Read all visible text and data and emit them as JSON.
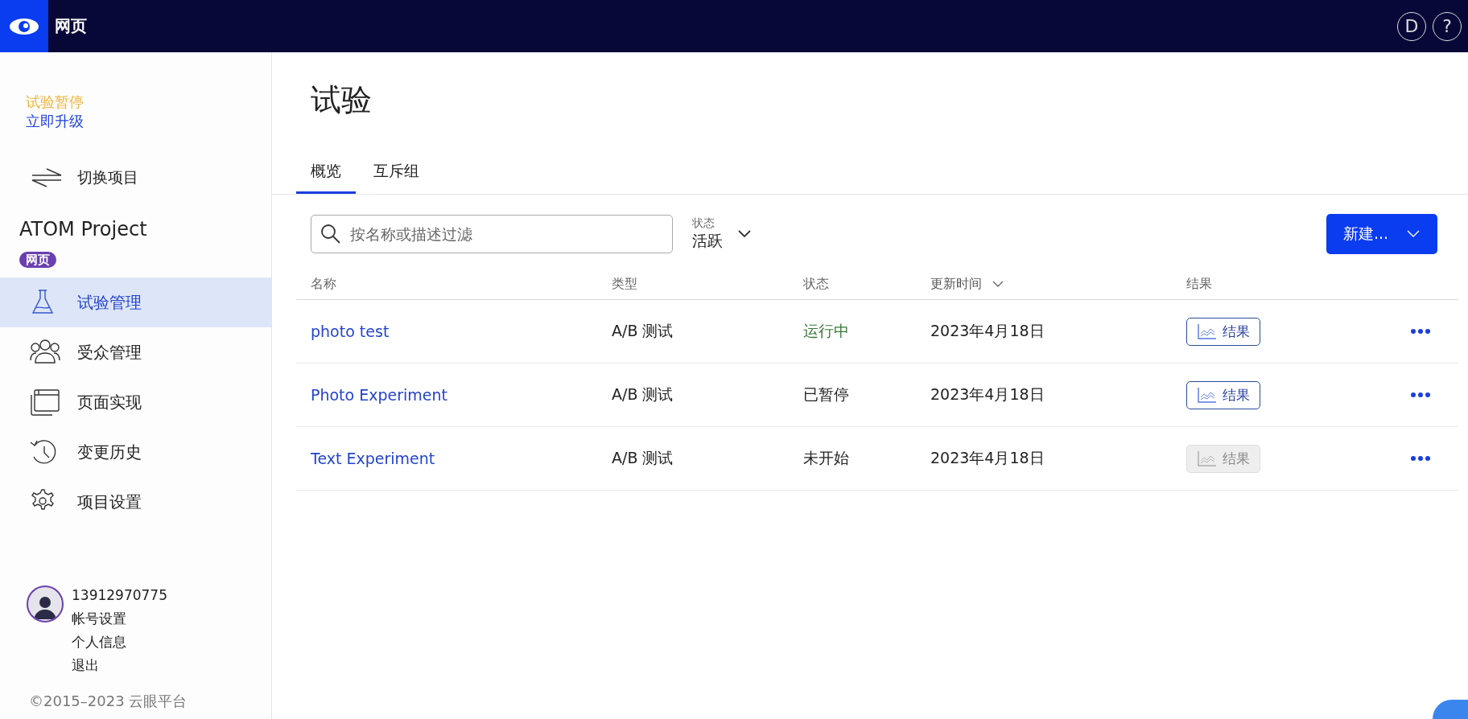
{
  "top_bar": {
    "title": "网页",
    "user_initial": "D",
    "help": "?"
  },
  "sidebar": {
    "trial_notice": "试验暂停",
    "upgrade_link": "立即升级",
    "switch_project": "切换项目",
    "project_name": "ATOM Project",
    "project_badge": "网页",
    "items": [
      {
        "label": "试验管理",
        "selected": true
      },
      {
        "label": "受众管理",
        "selected": false
      },
      {
        "label": "页面实现",
        "selected": false
      },
      {
        "label": "变更历史",
        "selected": false
      },
      {
        "label": "项目设置",
        "selected": false
      }
    ],
    "user": {
      "name": "13912970775",
      "links": [
        "帐号设置",
        "个人信息",
        "退出"
      ]
    },
    "footer": "©2015–2023 云眼平台"
  },
  "main": {
    "title": "试验",
    "tabs": [
      {
        "label": "概览",
        "selected": true
      },
      {
        "label": "互斥组",
        "selected": false
      }
    ],
    "search": {
      "placeholder": "按名称或描述过滤"
    },
    "status_filter": {
      "label": "状态",
      "value": "活跃"
    },
    "new_button": "新建...",
    "table": {
      "columns": [
        {
          "label": "名称",
          "sorted": false
        },
        {
          "label": "类型",
          "sorted": false
        },
        {
          "label": "状态",
          "sorted": false
        },
        {
          "label": "更新时间",
          "sorted": true
        },
        {
          "label": "结果",
          "sorted": false
        }
      ],
      "rows": [
        {
          "name": "photo test",
          "type": "A/B 测试",
          "status": "运行中",
          "kind": "running",
          "updated": "2023年4月18日",
          "result": "结果",
          "result_disabled": false
        },
        {
          "name": "Photo Experiment",
          "type": "A/B 测试",
          "status": "已暂停",
          "kind": "paused",
          "updated": "2023年4月18日",
          "result": "结果",
          "result_disabled": false
        },
        {
          "name": "Text Experiment",
          "type": "A/B 测试",
          "status": "未开始",
          "kind": "not_started",
          "updated": "2023年4月18日",
          "result": "结果",
          "result_disabled": true
        }
      ]
    }
  }
}
